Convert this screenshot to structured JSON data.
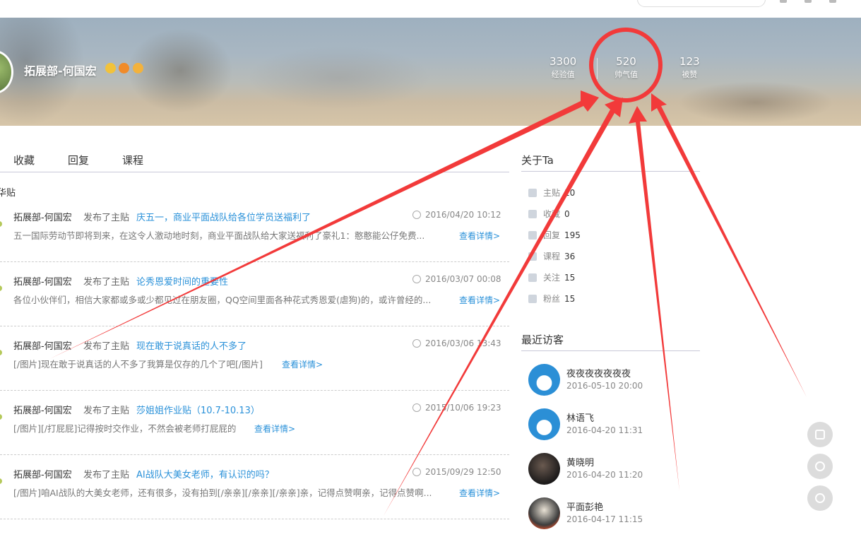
{
  "header": {
    "username": "拓展部-何国宏",
    "stats": [
      {
        "num": "3300",
        "label": "经验值"
      },
      {
        "num": "520",
        "label": "帅气值"
      },
      {
        "num": "123",
        "label": "被赞"
      }
    ]
  },
  "tabs": [
    "收藏",
    "回复",
    "课程"
  ],
  "subhead": "华贴",
  "posts": [
    {
      "author": "拓展部-何国宏",
      "verb": "发布了主贴",
      "title": "庆五一，商业平面战队给各位学员送福利了",
      "date": "2016/04/20 10:12",
      "excerpt": "五一国际劳动节即将到来，在这令人激动地时刻，商业平面战队给大家送福利了豪礼1：憨憨能公仔免费...",
      "more": "查看详情>"
    },
    {
      "author": "拓展部-何国宏",
      "verb": "发布了主贴",
      "title": "论秀恩爱时间的重要性",
      "date": "2016/03/07 00:08",
      "excerpt": "各位小伙伴们，相信大家都或多或少都见过在朋友圈，QQ空间里面各种花式秀恩爱(虐狗)的，或许曾经的...",
      "more": "查看详情>"
    },
    {
      "author": "拓展部-何国宏",
      "verb": "发布了主贴",
      "title": "现在敢于说真话的人不多了",
      "date": "2016/03/06 13:43",
      "excerpt": "[/图片]现在敢于说真话的人不多了我算是仅存的几个了吧[/图片]",
      "more": "查看详情>"
    },
    {
      "author": "拓展部-何国宏",
      "verb": "发布了主贴",
      "title": "莎姐姐作业贴（10.7-10.13）",
      "date": "2015/10/06 19:23",
      "excerpt": "[/图片][/打屁屁]记得按时交作业，不然会被老师打屁屁的",
      "more": "查看详情>"
    },
    {
      "author": "拓展部-何国宏",
      "verb": "发布了主贴",
      "title": "AI战队大美女老师，有认识的吗？",
      "date": "2015/09/29 12:50",
      "excerpt": "[/图片]咱AI战队的大美女老师，还有很多，没有拍到[/亲亲][/亲亲][/亲亲]亲，记得点赞啊亲，记得点赞啊...",
      "more": "查看详情>"
    }
  ],
  "about": {
    "heading": "关于Ta",
    "rows": [
      {
        "label": "主贴",
        "value": "10",
        "icon": "document-icon"
      },
      {
        "label": "收藏",
        "value": "0",
        "icon": "heart-icon"
      },
      {
        "label": "回复",
        "value": "195",
        "icon": "comment-icon"
      },
      {
        "label": "课程",
        "value": "36",
        "icon": "course-icon"
      },
      {
        "label": "关注",
        "value": "15",
        "icon": "user-icon"
      },
      {
        "label": "粉丝",
        "value": "15",
        "icon": "fans-icon"
      }
    ]
  },
  "visitors": {
    "heading": "最近访客",
    "items": [
      {
        "name": "夜夜夜夜夜夜夜",
        "time": "2016-05-10 20:00"
      },
      {
        "name": "林语飞",
        "time": "2016-04-20 11:31"
      },
      {
        "name": "黄晓明",
        "time": "2016-04-20 11:20"
      },
      {
        "name": "平面彭艳",
        "time": "2016-04-17 11:15"
      }
    ]
  },
  "colors": {
    "link": "#2a91d9",
    "annotation": "#f23a3a"
  }
}
